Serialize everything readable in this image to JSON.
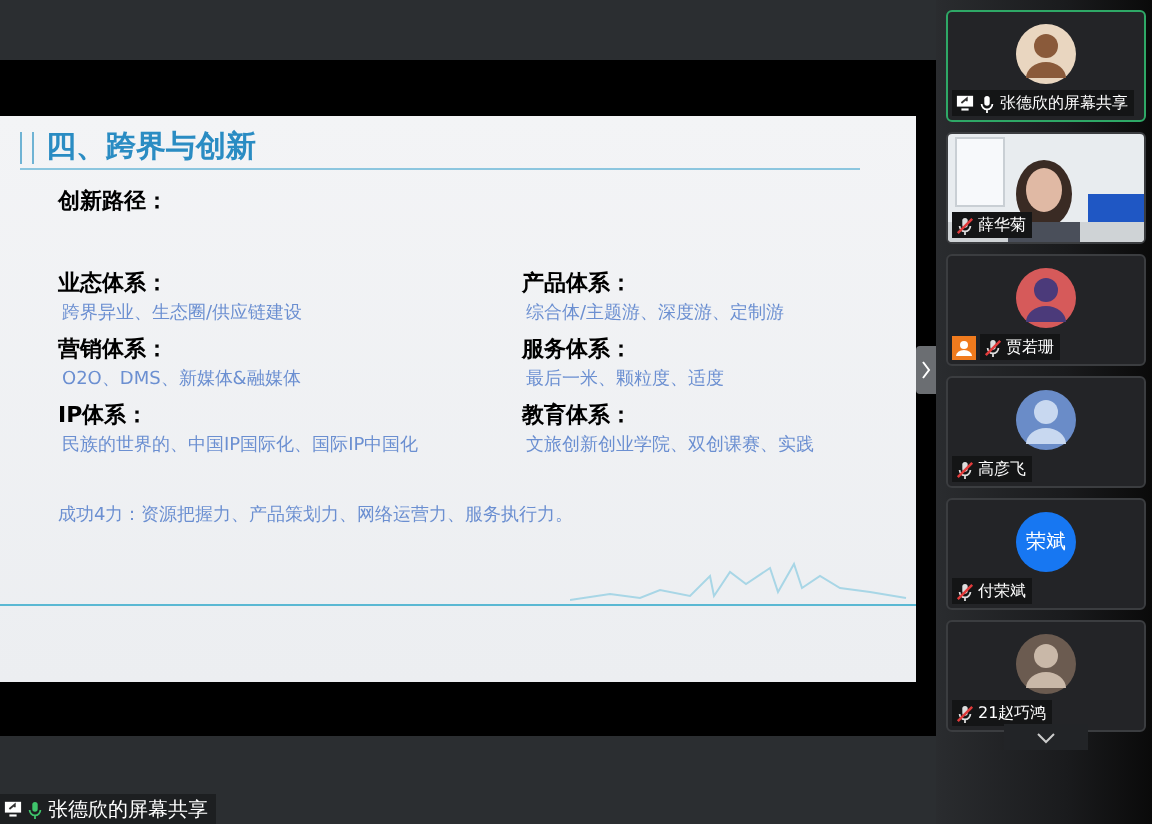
{
  "slide": {
    "title": "四、跨界与创新",
    "subtitle": "创新路径：",
    "sections": [
      {
        "heading": "业态体系：",
        "body": "跨界异业、生态圈/供应链建设"
      },
      {
        "heading": "产品体系：",
        "body": "综合体/主题游、深度游、定制游"
      },
      {
        "heading": "营销体系：",
        "body": "O2O、DMS、新媒体&融媒体"
      },
      {
        "heading": "服务体系：",
        "body": "最后一米、颗粒度、适度"
      },
      {
        "heading": "IP体系：",
        "body": "民族的世界的、中国IP国际化、国际IP中国化"
      },
      {
        "heading": "教育体系：",
        "body": "文旅创新创业学院、双创课赛、实践"
      }
    ],
    "footer": "成功4力：资源把握力、产品策划力、网络运营力、服务执行力。"
  },
  "share_label": "张德欣的屏幕共享",
  "participants": [
    {
      "name": "张德欣的屏幕共享",
      "kind": "avatar",
      "speaking": true,
      "muted": false,
      "sharing": true,
      "host": false
    },
    {
      "name": "薛华菊",
      "kind": "video",
      "speaking": false,
      "muted": true,
      "sharing": false,
      "host": false
    },
    {
      "name": "贾若珊",
      "kind": "avatar",
      "speaking": false,
      "muted": true,
      "sharing": false,
      "host": true
    },
    {
      "name": "高彦飞",
      "kind": "avatar",
      "speaking": false,
      "muted": true,
      "sharing": false,
      "host": false
    },
    {
      "name": "付荣斌",
      "kind": "initials",
      "initials": "荣斌",
      "speaking": false,
      "muted": true,
      "sharing": false,
      "host": false
    },
    {
      "name": "21赵巧鸿",
      "kind": "avatar",
      "speaking": false,
      "muted": true,
      "sharing": false,
      "host": false
    }
  ]
}
